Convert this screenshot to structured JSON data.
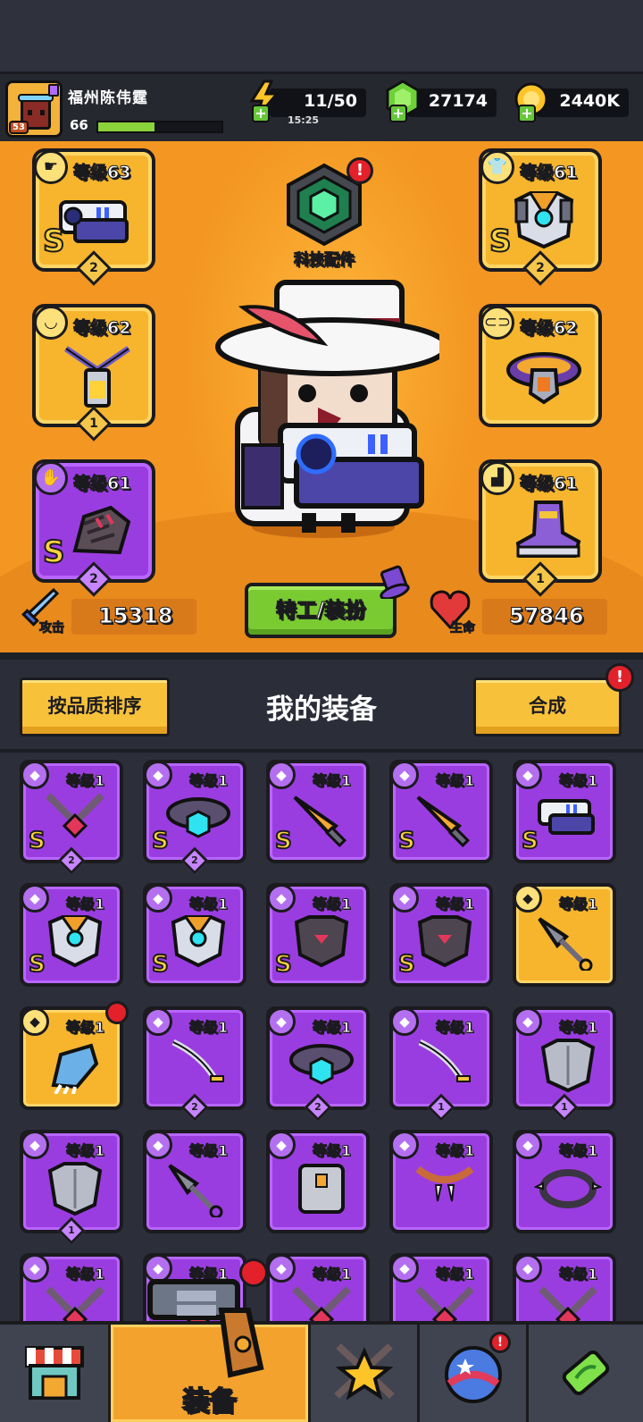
{
  "player": {
    "name": "福州陈伟霆",
    "level": "66",
    "avatar_level": "53",
    "xp_fraction": 0.46
  },
  "resources": {
    "energy": {
      "value": "11/50",
      "timer": "15:25",
      "icon": "lightning-icon"
    },
    "gems": {
      "value": "27174",
      "icon": "green-gem-icon"
    },
    "coins": {
      "value": "2440K",
      "icon": "gold-coin-icon"
    }
  },
  "slots": {
    "weapon": {
      "level": "等级63",
      "grade": "S",
      "stars": "2",
      "rarity": "gold",
      "icon": "blaster-gun-icon"
    },
    "armor": {
      "level": "等级61",
      "grade": "S",
      "stars": "2",
      "rarity": "gold",
      "icon": "robot-armor-icon"
    },
    "necklace": {
      "level": "等级62",
      "stars": "1",
      "rarity": "gold",
      "icon": "battery-necklace-icon"
    },
    "belt": {
      "level": "等级62",
      "rarity": "gold",
      "icon": "belt-icon"
    },
    "gloves": {
      "level": "等级61",
      "grade": "S",
      "stars": "2",
      "rarity": "purple",
      "icon": "gauntlet-icon"
    },
    "boots": {
      "level": "等级61",
      "stars": "1",
      "rarity": "gold",
      "icon": "boots-icon"
    }
  },
  "tech": {
    "label": "科技配件",
    "alert": "!"
  },
  "stats": {
    "attack": {
      "label": "攻击",
      "value": "15318",
      "icon": "sword-icon"
    },
    "hp": {
      "label": "生命",
      "value": "57846",
      "icon": "heart-icon"
    }
  },
  "dress_button": "特工/装扮",
  "equipment": {
    "sort_button": "按品质排序",
    "title": "我的装备",
    "merge_button": "合成",
    "merge_alert": "!"
  },
  "items": [
    {
      "level": "等级1",
      "rarity": "purple",
      "grade": "S",
      "stars": "2",
      "icon": "necklace-icon"
    },
    {
      "level": "等级1",
      "rarity": "purple",
      "grade": "S",
      "stars": "2",
      "icon": "belt-icon"
    },
    {
      "level": "等级1",
      "rarity": "purple",
      "grade": "S",
      "stars": "",
      "icon": "fire-sword-icon"
    },
    {
      "level": "等级1",
      "rarity": "purple",
      "grade": "S",
      "stars": "",
      "icon": "fire-sword-icon"
    },
    {
      "level": "等级1",
      "rarity": "purple",
      "grade": "S",
      "stars": "",
      "icon": "blaster-gun-icon"
    },
    {
      "level": "等级1",
      "rarity": "purple",
      "grade": "S",
      "stars": "",
      "icon": "robot-armor-icon"
    },
    {
      "level": "等级1",
      "rarity": "purple",
      "grade": "S",
      "stars": "",
      "icon": "robot-armor-icon"
    },
    {
      "level": "等级1",
      "rarity": "purple",
      "grade": "S",
      "stars": "",
      "icon": "dark-armor-icon"
    },
    {
      "level": "等级1",
      "rarity": "purple",
      "grade": "S",
      "stars": "",
      "icon": "dark-armor-icon"
    },
    {
      "level": "等级1",
      "rarity": "gold",
      "grade": "",
      "stars": "",
      "icon": "kunai-icon"
    },
    {
      "level": "等级1",
      "rarity": "gold",
      "grade": "",
      "stars": "",
      "icon": "claw-glove-icon",
      "new": true
    },
    {
      "level": "等级1",
      "rarity": "purple",
      "grade": "",
      "stars": "2",
      "icon": "katana-icon"
    },
    {
      "level": "等级1",
      "rarity": "purple",
      "grade": "",
      "stars": "2",
      "icon": "belt-icon"
    },
    {
      "level": "等级1",
      "rarity": "purple",
      "grade": "",
      "stars": "1",
      "icon": "katana-icon"
    },
    {
      "level": "等级1",
      "rarity": "purple",
      "grade": "",
      "stars": "1",
      "icon": "steel-armor-icon"
    },
    {
      "level": "等级1",
      "rarity": "purple",
      "grade": "",
      "stars": "1",
      "icon": "steel-armor-icon"
    },
    {
      "level": "等级1",
      "rarity": "purple",
      "grade": "",
      "stars": "",
      "icon": "kunai-icon"
    },
    {
      "level": "等级1",
      "rarity": "purple",
      "grade": "",
      "stars": "",
      "icon": "vest-armor-icon"
    },
    {
      "level": "等级1",
      "rarity": "purple",
      "grade": "",
      "stars": "",
      "icon": "fang-necklace-icon"
    },
    {
      "level": "等级1",
      "rarity": "purple",
      "grade": "",
      "stars": "",
      "icon": "spike-collar-icon"
    },
    {
      "level": "等级1",
      "rarity": "purple",
      "grade": "",
      "stars": "",
      "icon": "necklace-icon"
    },
    {
      "level": "等级1",
      "rarity": "purple",
      "grade": "",
      "stars": "",
      "icon": "necklace-icon"
    },
    {
      "level": "等级1",
      "rarity": "purple",
      "grade": "",
      "stars": "",
      "icon": "necklace-icon"
    },
    {
      "level": "等级1",
      "rarity": "purple",
      "grade": "",
      "stars": "",
      "icon": "necklace-icon"
    },
    {
      "level": "等级1",
      "rarity": "purple",
      "grade": "",
      "stars": "",
      "icon": "necklace-icon"
    }
  ],
  "nav": {
    "shop": {
      "icon": "shop-icon"
    },
    "equip": {
      "label": "装备",
      "icon": "revolver-icon"
    },
    "challenge": {
      "icon": "star-swords-icon"
    },
    "world": {
      "icon": "planet-icon",
      "alert": "!"
    },
    "lab": {
      "icon": "dna-capsule-icon"
    }
  },
  "colors": {
    "gold_rarity": "#f6b52d",
    "purple_rarity": "#9a3de0",
    "hero_bg": "#f39622",
    "accent_green": "#7acb32",
    "alert_red": "#e2212a"
  }
}
